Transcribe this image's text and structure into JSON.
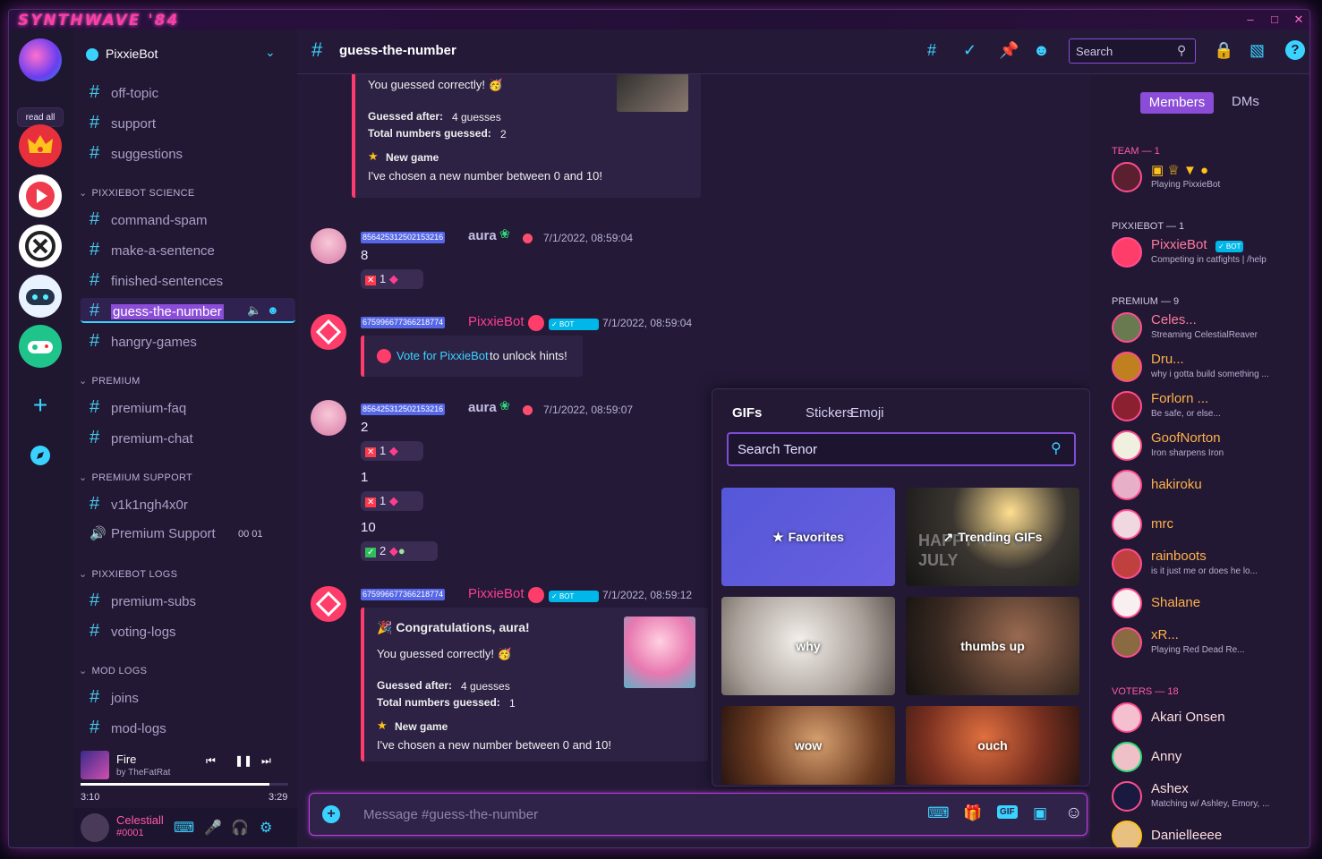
{
  "titlebar": {
    "brand": "SYNTHWAVE '84"
  },
  "servers": {
    "read_all": "read all"
  },
  "guild": {
    "name": "PixxieBot"
  },
  "channels": [
    {
      "kind": "text",
      "label": "off-topic"
    },
    {
      "kind": "text",
      "label": "support"
    },
    {
      "kind": "text",
      "label": "suggestions"
    },
    {
      "kind": "category",
      "label": "PIXXIEBOT SCIENCE"
    },
    {
      "kind": "text",
      "label": "command-spam"
    },
    {
      "kind": "text",
      "label": "make-a-sentence"
    },
    {
      "kind": "text",
      "label": "finished-sentences"
    },
    {
      "kind": "active",
      "label": "guess-the-number"
    },
    {
      "kind": "text",
      "label": "hangry-games"
    },
    {
      "kind": "category",
      "label": "PREMIUM"
    },
    {
      "kind": "text",
      "label": "premium-faq"
    },
    {
      "kind": "text",
      "label": "premium-chat"
    },
    {
      "kind": "category",
      "label": "PREMIUM SUPPORT"
    },
    {
      "kind": "text",
      "label": "v1k1ngh4x0r"
    },
    {
      "kind": "voice",
      "label": "Premium Support",
      "counts": "00  01"
    },
    {
      "kind": "category",
      "label": "PIXXIEBOT LOGS"
    },
    {
      "kind": "text",
      "label": "premium-subs"
    },
    {
      "kind": "text",
      "label": "voting-logs"
    },
    {
      "kind": "category",
      "label": "MOD LOGS"
    },
    {
      "kind": "text",
      "label": "joins"
    },
    {
      "kind": "text",
      "label": "mod-logs"
    }
  ],
  "player": {
    "song": "Fire",
    "artist": "by TheFatRat",
    "elapsed": "3:10",
    "total": "3:29",
    "progress": 0.91
  },
  "user": {
    "name": "Celestiall",
    "tag": "#0001"
  },
  "topbar": {
    "channel": "guess-the-number",
    "search_placeholder": "Search"
  },
  "messages": {
    "embed0": {
      "line1": "You guessed correctly! 🥳",
      "guessed_label": "Guessed after:",
      "guessed_val": "4 guesses",
      "total_label": "Total numbers guessed:",
      "total_val": "2",
      "new_game": "New game",
      "chosen": "I've chosen a new number between 0 and 10!"
    },
    "m1": {
      "id": "856425312502153216",
      "name": "aura",
      "time": "7/1/2022, 08:59:04",
      "text": "8",
      "react_count": "1"
    },
    "m2": {
      "id": "675996677366218774",
      "name": "PixxieBot",
      "bot": "BOT",
      "time": "7/1/2022, 08:59:04",
      "vote_link": "Vote for PixxieBot",
      "vote_rest": " to unlock hints!"
    },
    "m3": {
      "id": "856425312502153216",
      "name": "aura",
      "time": "7/1/2022, 08:59:07",
      "t1": "2",
      "c1": "1",
      "t2": "1",
      "c2": "1",
      "t3": "10",
      "c3": "2"
    },
    "m4": {
      "id": "675996677366218774",
      "name": "PixxieBot",
      "bot": "BOT",
      "time": "7/1/2022, 08:59:12",
      "congrats": "Congratulations, aura!",
      "line1": "You guessed correctly! 🥳",
      "guessed_label": "Guessed after:",
      "guessed_val": "4 guesses",
      "total_label": "Total numbers guessed:",
      "total_val": "1",
      "new_game": "New game",
      "chosen": "I've chosen a new number between 0 and 10!"
    }
  },
  "composer": {
    "placeholder": "Message #guess-the-number"
  },
  "gifpanel": {
    "tabs": [
      "GIFs",
      "Stickers",
      "Emoji"
    ],
    "search_placeholder": "Search Tenor",
    "tiles": [
      "Favorites",
      "Trending GIFs",
      "why",
      "thumbs up",
      "wow",
      "ouch"
    ],
    "tile_bg_text": [
      "",
      "HAPPY 4TH OF JULY",
      "",
      "",
      "",
      ""
    ]
  },
  "members_tabs": {
    "members": "Members",
    "dms": "DMs"
  },
  "groups": [
    {
      "label": "TEAM — 1"
    },
    {
      "label": "PIXXIEBOT — 1"
    },
    {
      "label": "PREMIUM — 9"
    },
    {
      "label": "VOTERS — 18"
    }
  ],
  "members": [
    {
      "name": "",
      "status": "Playing PixxieBot"
    },
    {
      "name": "PixxieBot",
      "status": "Competing in catfights | /help"
    },
    {
      "name": "Celes...",
      "status": "Streaming CelestialReaver"
    },
    {
      "name": "Dru...",
      "status": "why i gotta build something ..."
    },
    {
      "name": "Forlorn ...",
      "status": "Be safe, or else..."
    },
    {
      "name": "GoofNorton",
      "status": "Iron sharpens Iron"
    },
    {
      "name": "hakiroku",
      "status": ""
    },
    {
      "name": "mrc",
      "status": ""
    },
    {
      "name": "rainboots",
      "status": "is it just me or does he lo..."
    },
    {
      "name": "Shalane",
      "status": ""
    },
    {
      "name": "xR...",
      "status": "Playing Red Dead Re..."
    },
    {
      "name": "Akari Onsen",
      "status": ""
    },
    {
      "name": "Anny",
      "status": ""
    },
    {
      "name": "Ashex",
      "status": "Matching w/ Ashley, Emory, ..."
    },
    {
      "name": "Danielleeee",
      "status": ""
    }
  ],
  "colors": {
    "accent": "#ff3d8f",
    "cyan": "#3ad3ff",
    "purple": "#8b4dd8",
    "bg": "#241a38"
  }
}
